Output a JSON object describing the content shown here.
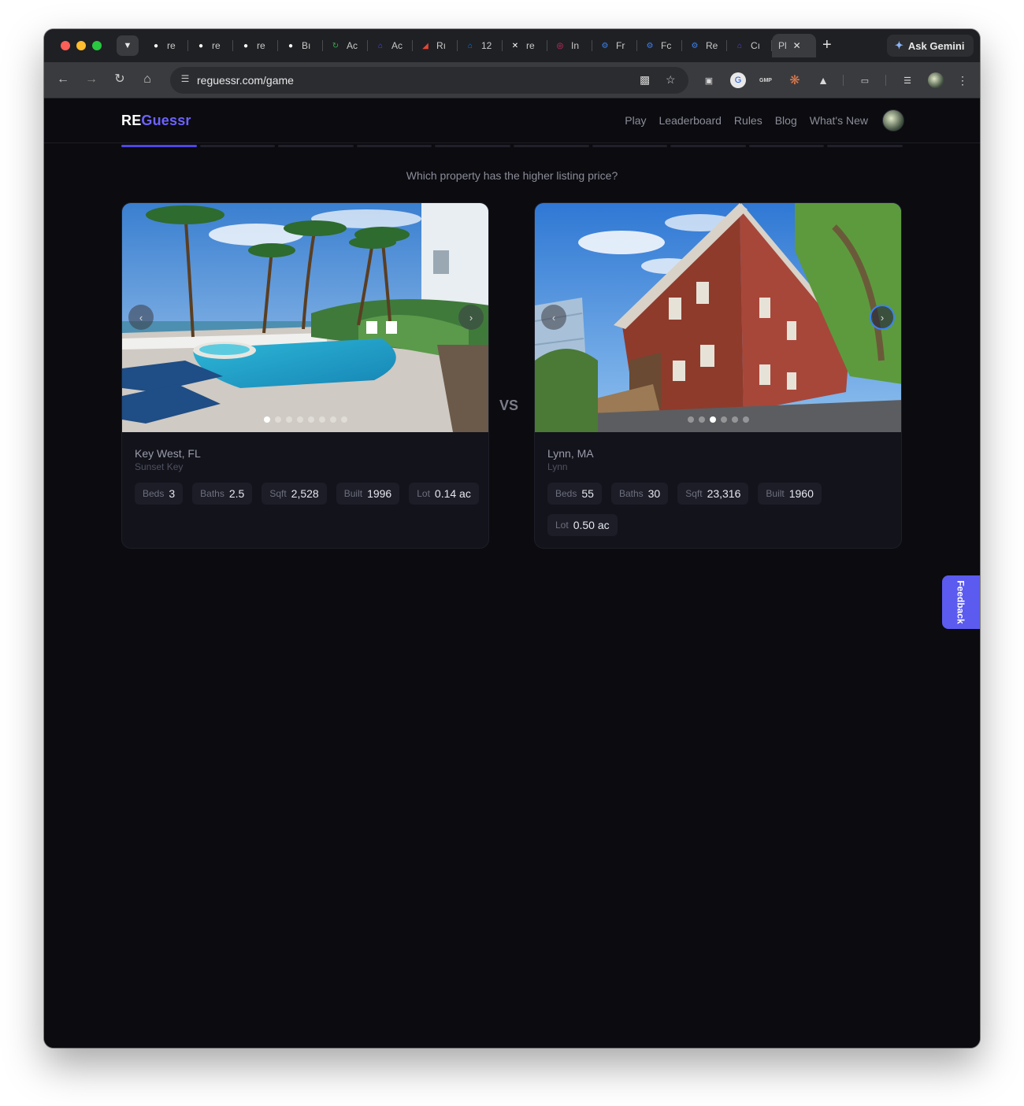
{
  "browser": {
    "tabs": [
      {
        "label": "re",
        "icon": "github-icon",
        "color": "#ffffff"
      },
      {
        "label": "re",
        "icon": "github-icon",
        "color": "#ffffff"
      },
      {
        "label": "re",
        "icon": "github-icon",
        "color": "#ffffff"
      },
      {
        "label": "Bı",
        "icon": "github-icon",
        "color": "#ffffff"
      },
      {
        "label": "Ac",
        "icon": "github-actions-icon",
        "color": "#34a853"
      },
      {
        "label": "Ac",
        "icon": "home-icon",
        "color": "#4f46e5"
      },
      {
        "label": "Rı",
        "icon": "chart-icon",
        "color": "#ea4335"
      },
      {
        "label": "12",
        "icon": "zillow-icon",
        "color": "#1277e1"
      },
      {
        "label": "re",
        "icon": "x-icon",
        "color": "#ffffff"
      },
      {
        "label": "In",
        "icon": "instagram-icon",
        "color": "#e1306c"
      },
      {
        "label": "Fr",
        "icon": "gear-icon",
        "color": "#3b82f6"
      },
      {
        "label": "Fc",
        "icon": "gear-icon",
        "color": "#3b82f6"
      },
      {
        "label": "Re",
        "icon": "gear-icon",
        "color": "#3b82f6"
      },
      {
        "label": "Cı",
        "icon": "home-icon",
        "color": "#4f46e5"
      },
      {
        "label": "Pl",
        "icon": "",
        "color": "#ffffff",
        "active": true
      }
    ],
    "gemini_label": "Ask Gemini",
    "url": "reguessr.com/game"
  },
  "site": {
    "logo_re": "RE",
    "logo_guessr": "Guessr",
    "nav": [
      "Play",
      "Leaderboard",
      "Rules",
      "Blog",
      "What's New"
    ],
    "progress": {
      "total": 10,
      "current": 1
    },
    "question": "Which property has the higher listing price?",
    "vs": "VS",
    "feedback": "Feedback"
  },
  "properties": [
    {
      "location": "Key West, FL",
      "sublocation": "Sunset Key",
      "photo_count": 8,
      "photo_index": 0,
      "stats": [
        {
          "k": "Beds",
          "v": "3"
        },
        {
          "k": "Baths",
          "v": "2.5"
        },
        {
          "k": "Sqft",
          "v": "2,528"
        },
        {
          "k": "Built",
          "v": "1996"
        },
        {
          "k": "Lot",
          "v": "0.14 ac"
        }
      ]
    },
    {
      "location": "Lynn, MA",
      "sublocation": "Lynn",
      "photo_count": 6,
      "photo_index": 2,
      "stats": [
        {
          "k": "Beds",
          "v": "55"
        },
        {
          "k": "Baths",
          "v": "30"
        },
        {
          "k": "Sqft",
          "v": "23,316"
        },
        {
          "k": "Built",
          "v": "1960"
        },
        {
          "k": "Lot",
          "v": "0.50 ac"
        }
      ]
    }
  ],
  "colors": {
    "accent": "#6c63ff",
    "progress": "#4f46e5",
    "feedback": "#5b5bf0"
  }
}
